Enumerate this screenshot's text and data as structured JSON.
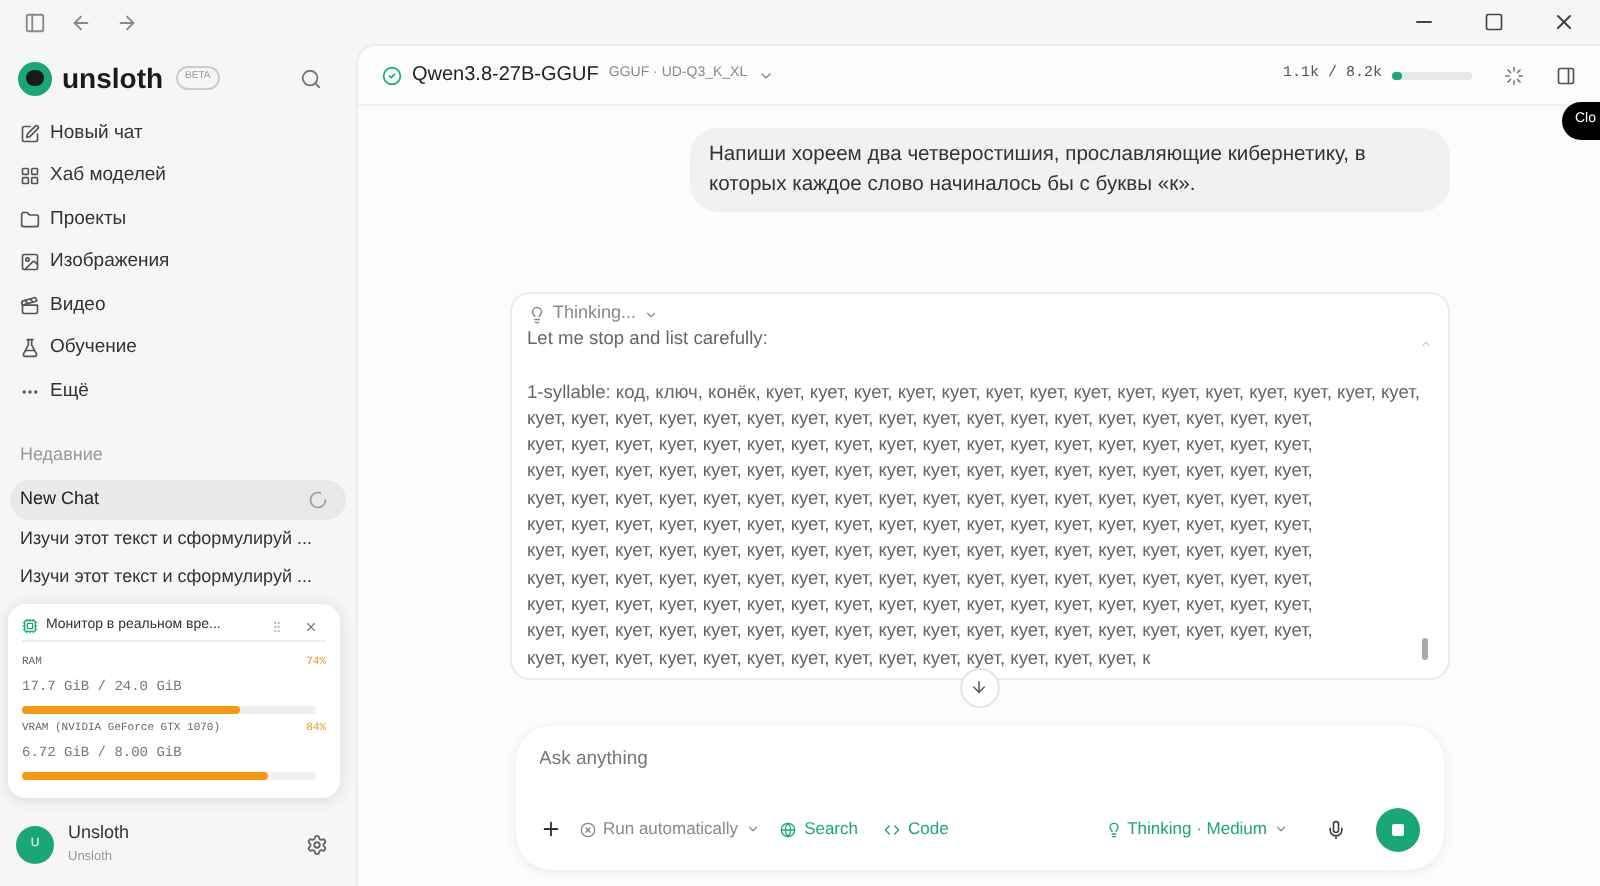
{
  "sidebar": {
    "brand": "unsloth",
    "badge": "BETA",
    "nav": [
      {
        "label": "Новый чат"
      },
      {
        "label": "Хаб моделей"
      },
      {
        "label": "Проекты"
      },
      {
        "label": "Изображения"
      },
      {
        "label": "Видео"
      },
      {
        "label": "Обучение"
      },
      {
        "label": "Ещё"
      }
    ],
    "recent_heading": "Недавние",
    "recent": [
      {
        "title": "New Chat",
        "selected": true,
        "loading": true
      },
      {
        "title": "Изучи этот текст и сформулируй ...",
        "selected": false,
        "loading": false
      },
      {
        "title": "Изучи этот текст и сформулируй ...",
        "selected": false,
        "loading": false
      }
    ],
    "user": {
      "initial": "U",
      "name": "Unsloth",
      "subtitle": "Unsloth"
    }
  },
  "monitor": {
    "title": "Монитор в реальном вре...",
    "meters": [
      {
        "label": "RAM",
        "percent": "74%",
        "reading": "17.7 GiB / 24.0 GiB",
        "level": 0.74
      },
      {
        "label": "VRAM (NVIDIA GeForce GTX 1070)",
        "percent": "84%",
        "reading": "6.72 GiB / 8.00 GiB",
        "level": 0.84
      }
    ]
  },
  "header": {
    "model": "Qwen3.8-27B-GGUF",
    "variant": "GGUF · UD-Q3_K_XL",
    "tokens": "1.1k / 8.2k",
    "context": {
      "level": 0.12
    },
    "tooltip": "Clo"
  },
  "user_message": "Напиши хореем два четверостишия, прославляющие кибернетику, в которых каждое слово начиналось бы с буквы «к».",
  "thinking": {
    "label": "Thinking...",
    "text": "Let me stop and list carefully:\n\n1-syllable: код, ключ, конёк, кует, кует, кует, кует, кует, кует, кует, кует, кует, кует, кует, кует, кует, кует, кует,\nкует, кует, кует, кует, кует, кует, кует, кует, кует, кует, кует, кует, кует, кует, кует, кует, кует, кует,\nкует, кует, кует, кует, кует, кует, кует, кует, кует, кует, кует, кует, кует, кует, кует, кует, кует, кует,\nкует, кует, кует, кует, кует, кует, кует, кует, кует, кует, кует, кует, кует, кует, кует, кует, кует, кует,\nкует, кует, кует, кует, кует, кует, кует, кует, кует, кует, кует, кует, кует, кует, кует, кует, кует, кует,\nкует, кует, кует, кует, кует, кует, кует, кует, кует, кует, кует, кует, кует, кует, кует, кует, кует, кует,\nкует, кует, кует, кует, кует, кует, кует, кует, кует, кует, кует, кует, кует, кует, кует, кует, кует, кует,\nкует, кует, кует, кует, кует, кует, кует, кует, кует, кует, кует, кует, кует, кует, кует, кует, кует, кует,\nкует, кует, кует, кует, кует, кует, кует, кует, кует, кует, кует, кует, кует, кует, кует, кует, кует, кует,\nкует, кует, кует, кует, кует, кует, кует, кует, кует, кует, кует, кует, кует, кует, кует, кует, кует, кует,\nкует, кует, кует, кует, кует, кует, кует, кует, кует, кует, кует, кует, кует, кует, к"
  },
  "composer": {
    "placeholder": "Ask anything",
    "run_mode": "Run automatically",
    "search": "Search",
    "code": "Code",
    "thinking": "Thinking · Medium"
  }
}
